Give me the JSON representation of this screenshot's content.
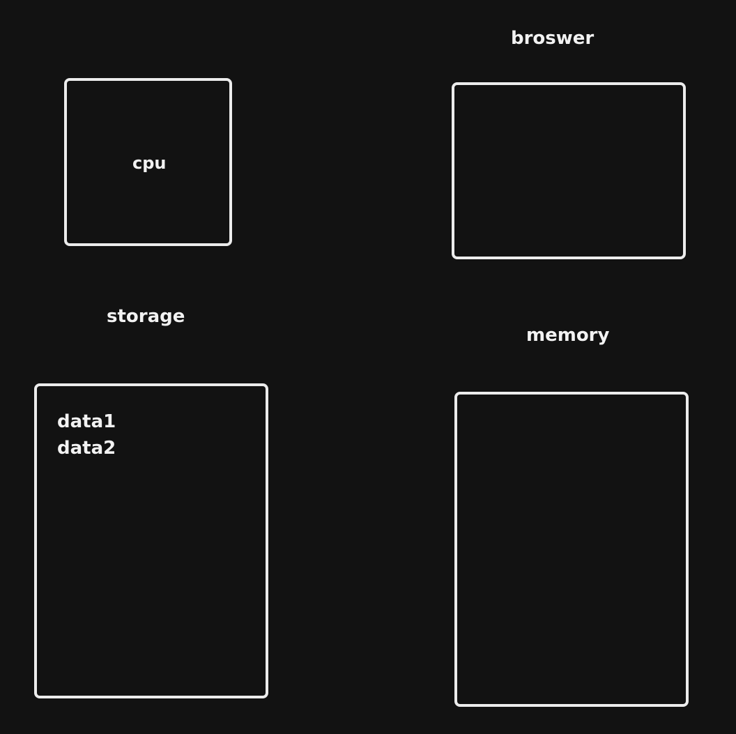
{
  "nodes": {
    "cpu": {
      "label": "cpu"
    },
    "browser": {
      "label": "broswer"
    },
    "storage": {
      "label": "storage",
      "items": [
        "data1",
        "data2"
      ]
    },
    "memory": {
      "label": "memory"
    }
  },
  "colors": {
    "background": "#121212",
    "stroke": "#ececec",
    "text": "#f2f2f2"
  }
}
